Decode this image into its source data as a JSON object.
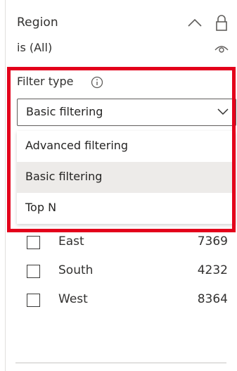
{
  "card": {
    "title": "Region",
    "subtitle": "is (All)"
  },
  "icons": {
    "collapse": "chevron-up-icon",
    "lock": "lock-icon",
    "visibility": "eye-icon",
    "info": "info-icon",
    "dropdown": "chevron-down-icon"
  },
  "filter_type": {
    "label": "Filter type",
    "selected": "Basic filtering",
    "options": [
      "Advanced filtering",
      "Basic filtering",
      "Top N"
    ]
  },
  "values": [
    {
      "label": "East",
      "count": "7369",
      "checked": false
    },
    {
      "label": "South",
      "count": "4232",
      "checked": false
    },
    {
      "label": "West",
      "count": "8364",
      "checked": false
    }
  ],
  "colors": {
    "highlight": "#e3001b",
    "hover": "#edebe9",
    "text": "#323130"
  }
}
